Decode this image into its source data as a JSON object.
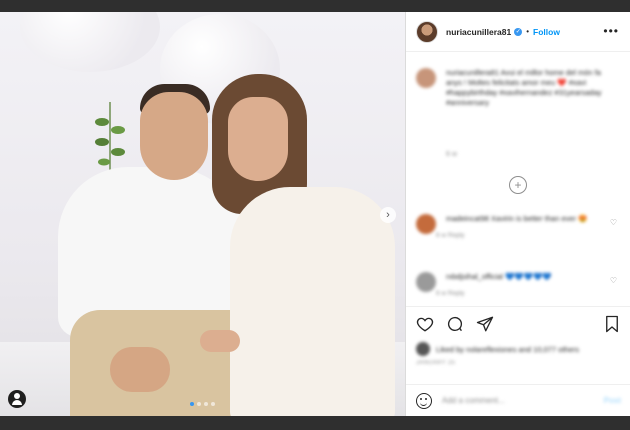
{
  "post": {
    "username": "nuriacunillera81",
    "follow_label": "Follow",
    "separator": "•",
    "more_label": "•••",
    "caption_text": "nuriacunillera81 Avui el millor home del món fa anys ! Moltes felicitats amor meu ❤️ #xavi #happybirthday #xavihernandez #31yearsaday #anniversary",
    "caption_meta": "6 w",
    "load_more_label": "+"
  },
  "comments": [
    {
      "text": "madeincat98 Xavirin is better than ever 😍",
      "meta": "6 w   Reply"
    },
    {
      "text": "rxbdjsihal_official 💙💙💙💙💙",
      "meta": "6 w   Reply"
    }
  ],
  "actions": {
    "likes_text": "Liked by nolareflexiones and 10,077 others",
    "date_text": "JANUARY 25"
  },
  "composer": {
    "placeholder": "Add a comment...",
    "post_label": "Post"
  },
  "carousel": {
    "next_label": "›",
    "slide_count": 4,
    "active_slide": 1
  },
  "colors": {
    "accent": "#0095f6",
    "verified": "#3897f0"
  }
}
